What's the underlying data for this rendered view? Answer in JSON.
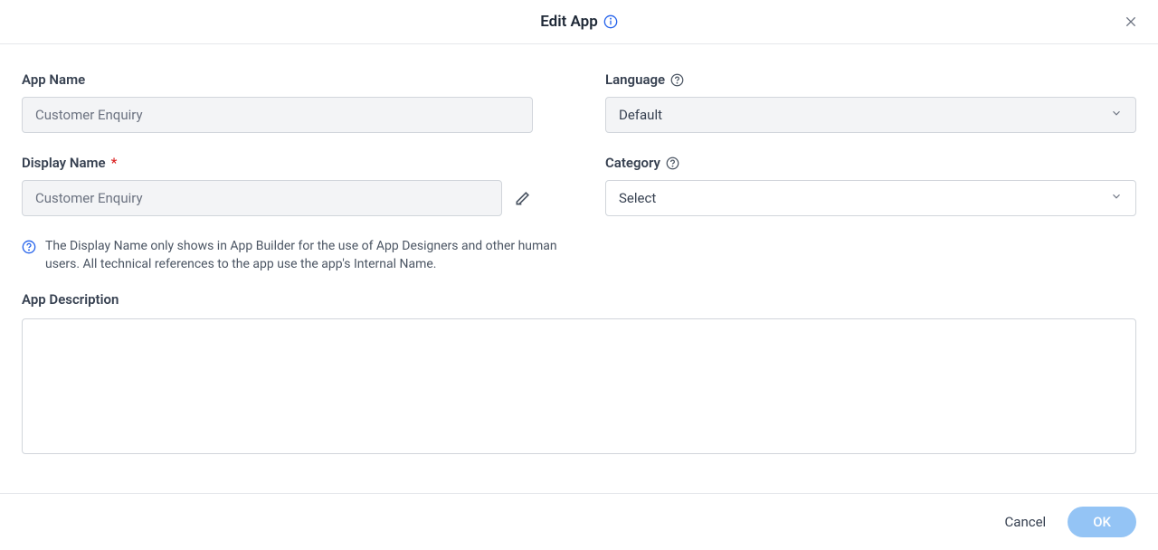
{
  "header": {
    "title": "Edit App"
  },
  "form": {
    "appName": {
      "label": "App Name",
      "value": "",
      "placeholder": "Customer Enquiry"
    },
    "displayName": {
      "label": "Display Name",
      "value": "",
      "placeholder": "Customer Enquiry",
      "hint": "The Display Name only shows in App Builder for the use of App Designers and other human users. All technical references to the app use the app's Internal Name."
    },
    "language": {
      "label": "Language",
      "selected": "Default"
    },
    "category": {
      "label": "Category",
      "selected": "Select"
    },
    "description": {
      "label": "App Description",
      "value": ""
    }
  },
  "footer": {
    "cancel": "Cancel",
    "ok": "OK"
  }
}
